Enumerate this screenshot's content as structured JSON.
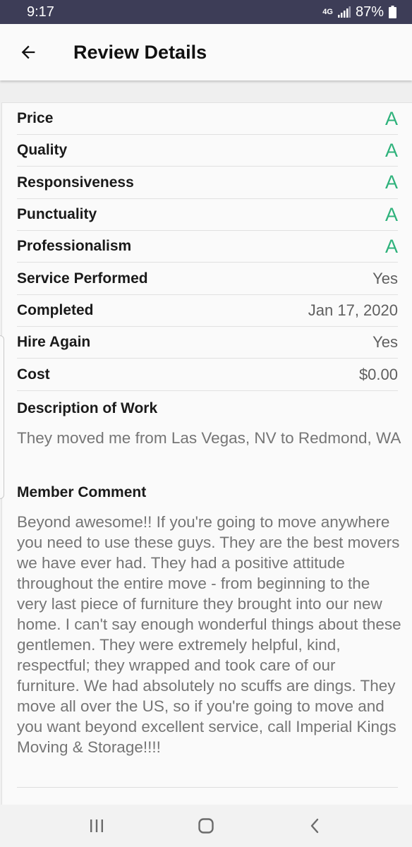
{
  "status_bar": {
    "time": "9:17",
    "network": "4G",
    "battery": "87%"
  },
  "header": {
    "title": "Review Details"
  },
  "ratings": [
    {
      "label": "Price",
      "value": "A"
    },
    {
      "label": "Quality",
      "value": "A"
    },
    {
      "label": "Responsiveness",
      "value": "A"
    },
    {
      "label": "Punctuality",
      "value": "A"
    },
    {
      "label": "Professionalism",
      "value": "A"
    }
  ],
  "details": [
    {
      "label": "Service Performed",
      "value": "Yes"
    },
    {
      "label": "Completed",
      "value": "Jan 17, 2020"
    },
    {
      "label": "Hire Again",
      "value": "Yes"
    },
    {
      "label": "Cost",
      "value": "$0.00"
    }
  ],
  "description": {
    "title": "Description of Work",
    "text": "They moved me from Las Vegas, NV to Redmond, WA"
  },
  "comment": {
    "title": "Member Comment",
    "text": "Beyond awesome!! If you're going to move anywhere you need to use these guys. They are the best movers we have ever had. They had a positive attitude throughout the entire move - from beginning to the very last piece of furniture they brought into our new home. I can't say enough wonderful things about these gentlemen. They were extremely helpful, kind, respectful; they wrapped and took care of our furniture. We had absolutely no scuffs are dings. They move all over the US, so if you're going to move and you want beyond excellent service, call Imperial Kings Moving & Storage!!!!"
  },
  "colors": {
    "grade": "#2eb27b",
    "status_bar": "#3d3d57"
  },
  "icons": {
    "back": "arrow-left-icon",
    "recents": "recents-icon",
    "home": "home-icon",
    "nav_back": "chevron-left-icon"
  }
}
